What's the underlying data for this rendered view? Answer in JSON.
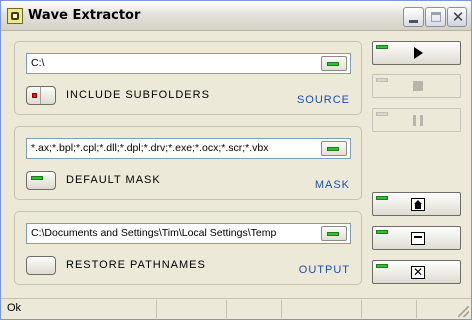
{
  "window": {
    "title": "Wave Extractor",
    "icons": {
      "app": "app-icon",
      "minimize": "minimize-icon",
      "maximize": "maximize-icon",
      "close": "close-icon"
    },
    "close_glyph": "✕"
  },
  "source": {
    "path": "C:\\",
    "option_label": "INCLUDE SUBFOLDERS",
    "group_label": "SOURCE"
  },
  "mask": {
    "value": "*.ax;*.bpl;*.cpl;*.dll;*.dpl;*.drv;*.exe;*.ocx;*.scr;*.vbx",
    "option_label": "DEFAULT MASK",
    "group_label": "MASK"
  },
  "output": {
    "path": "C:\\Documents and Settings\\Tim\\Local Settings\\Temp",
    "option_label": "RESTORE PATHNAMES",
    "group_label": "OUTPUT"
  },
  "actions": {
    "icons": [
      "play-icon",
      "stop-icon",
      "pause-icon",
      "home-icon",
      "minimize-icon",
      "exit-icon"
    ],
    "close_glyph": "✕"
  },
  "status": {
    "text": "Ok"
  },
  "colors": {
    "group_label": "#1f4fa8",
    "led_green": "#30c030",
    "led_red": "#e01818"
  }
}
